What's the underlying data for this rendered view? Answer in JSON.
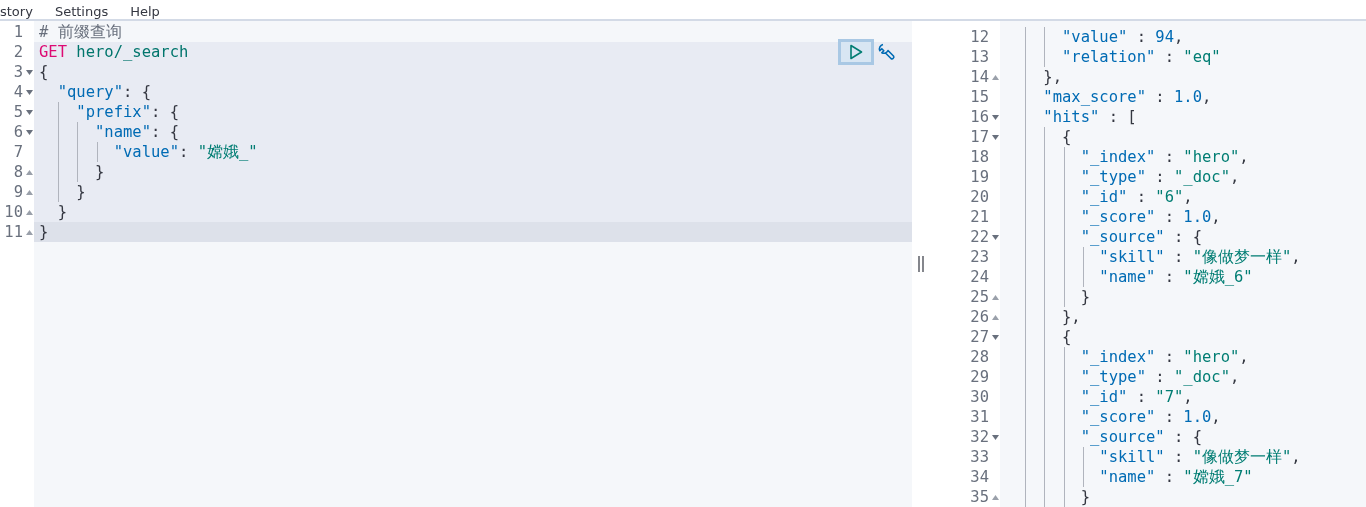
{
  "menu": [
    {
      "label": "story"
    },
    {
      "label": "Settings"
    },
    {
      "label": "Help"
    }
  ],
  "request_editor": {
    "lines": [
      {
        "number": "1",
        "fold_start": false,
        "fold_end": false,
        "in_request": false,
        "active": false,
        "tokens": [
          {
            "kind": "comment",
            "text": "# 前缀查询"
          }
        ]
      },
      {
        "number": "2",
        "fold_start": false,
        "fold_end": false,
        "in_request": true,
        "active": false,
        "tokens": [
          {
            "kind": "method",
            "text": "GET"
          },
          {
            "kind": "url",
            "text": " hero/_search"
          }
        ]
      },
      {
        "number": "3",
        "fold_start": true,
        "fold_end": false,
        "in_request": true,
        "active": false,
        "tokens": [
          {
            "kind": "punct",
            "text": "{"
          }
        ]
      },
      {
        "number": "4",
        "fold_start": true,
        "fold_end": false,
        "in_request": true,
        "active": false,
        "tokens": [
          {
            "kind": "key",
            "text": "  \"query\""
          },
          {
            "kind": "punct",
            "text": ": {"
          }
        ]
      },
      {
        "number": "5",
        "fold_start": true,
        "fold_end": false,
        "in_request": true,
        "active": false,
        "tokens": [
          {
            "kind": "key",
            "text": "    \"prefix\""
          },
          {
            "kind": "punct",
            "text": ": {"
          }
        ]
      },
      {
        "number": "6",
        "fold_start": true,
        "fold_end": false,
        "in_request": true,
        "active": false,
        "tokens": [
          {
            "kind": "key",
            "text": "      \"name\""
          },
          {
            "kind": "punct",
            "text": ": {"
          }
        ]
      },
      {
        "number": "7",
        "fold_start": false,
        "fold_end": false,
        "in_request": true,
        "active": false,
        "tokens": [
          {
            "kind": "key",
            "text": "        \"value\""
          },
          {
            "kind": "punct",
            "text": ": "
          },
          {
            "kind": "string",
            "text": "\"嫦娥_\""
          }
        ]
      },
      {
        "number": "8",
        "fold_start": false,
        "fold_end": true,
        "in_request": true,
        "active": false,
        "tokens": [
          {
            "kind": "punct",
            "text": "      }"
          }
        ]
      },
      {
        "number": "9",
        "fold_start": false,
        "fold_end": true,
        "in_request": true,
        "active": false,
        "tokens": [
          {
            "kind": "punct",
            "text": "    }"
          }
        ]
      },
      {
        "number": "10",
        "fold_start": false,
        "fold_end": true,
        "in_request": true,
        "active": false,
        "tokens": [
          {
            "kind": "punct",
            "text": "  }"
          }
        ]
      },
      {
        "number": "11",
        "fold_start": false,
        "fold_end": true,
        "in_request": true,
        "active": true,
        "tokens": [
          {
            "kind": "punct",
            "text": "}"
          }
        ]
      }
    ]
  },
  "response_viewer": {
    "lines": [
      {
        "number": "12",
        "fold_start": false,
        "fold_end": false,
        "tokens": [
          {
            "kind": "key",
            "text": "      \"value\""
          },
          {
            "kind": "punct",
            "text": " : "
          },
          {
            "kind": "number",
            "text": "94"
          },
          {
            "kind": "punct",
            "text": ","
          }
        ]
      },
      {
        "number": "13",
        "fold_start": false,
        "fold_end": false,
        "tokens": [
          {
            "kind": "key",
            "text": "      \"relation\""
          },
          {
            "kind": "punct",
            "text": " : "
          },
          {
            "kind": "string",
            "text": "\"eq\""
          }
        ]
      },
      {
        "number": "14",
        "fold_start": false,
        "fold_end": true,
        "tokens": [
          {
            "kind": "punct",
            "text": "    },"
          }
        ]
      },
      {
        "number": "15",
        "fold_start": false,
        "fold_end": false,
        "tokens": [
          {
            "kind": "key",
            "text": "    \"max_score\""
          },
          {
            "kind": "punct",
            "text": " : "
          },
          {
            "kind": "number",
            "text": "1.0"
          },
          {
            "kind": "punct",
            "text": ","
          }
        ]
      },
      {
        "number": "16",
        "fold_start": true,
        "fold_end": false,
        "tokens": [
          {
            "kind": "key",
            "text": "    \"hits\""
          },
          {
            "kind": "punct",
            "text": " : ["
          }
        ]
      },
      {
        "number": "17",
        "fold_start": true,
        "fold_end": false,
        "tokens": [
          {
            "kind": "punct",
            "text": "      {"
          }
        ]
      },
      {
        "number": "18",
        "fold_start": false,
        "fold_end": false,
        "tokens": [
          {
            "kind": "key",
            "text": "        \"_index\""
          },
          {
            "kind": "punct",
            "text": " : "
          },
          {
            "kind": "string",
            "text": "\"hero\""
          },
          {
            "kind": "punct",
            "text": ","
          }
        ]
      },
      {
        "number": "19",
        "fold_start": false,
        "fold_end": false,
        "tokens": [
          {
            "kind": "key",
            "text": "        \"_type\""
          },
          {
            "kind": "punct",
            "text": " : "
          },
          {
            "kind": "string",
            "text": "\"_doc\""
          },
          {
            "kind": "punct",
            "text": ","
          }
        ]
      },
      {
        "number": "20",
        "fold_start": false,
        "fold_end": false,
        "tokens": [
          {
            "kind": "key",
            "text": "        \"_id\""
          },
          {
            "kind": "punct",
            "text": " : "
          },
          {
            "kind": "string",
            "text": "\"6\""
          },
          {
            "kind": "punct",
            "text": ","
          }
        ]
      },
      {
        "number": "21",
        "fold_start": false,
        "fold_end": false,
        "tokens": [
          {
            "kind": "key",
            "text": "        \"_score\""
          },
          {
            "kind": "punct",
            "text": " : "
          },
          {
            "kind": "number",
            "text": "1.0"
          },
          {
            "kind": "punct",
            "text": ","
          }
        ]
      },
      {
        "number": "22",
        "fold_start": true,
        "fold_end": false,
        "tokens": [
          {
            "kind": "key",
            "text": "        \"_source\""
          },
          {
            "kind": "punct",
            "text": " : {"
          }
        ]
      },
      {
        "number": "23",
        "fold_start": false,
        "fold_end": false,
        "tokens": [
          {
            "kind": "key",
            "text": "          \"skill\""
          },
          {
            "kind": "punct",
            "text": " : "
          },
          {
            "kind": "string",
            "text": "\"像做梦一样\""
          },
          {
            "kind": "punct",
            "text": ","
          }
        ]
      },
      {
        "number": "24",
        "fold_start": false,
        "fold_end": false,
        "tokens": [
          {
            "kind": "key",
            "text": "          \"name\""
          },
          {
            "kind": "punct",
            "text": " : "
          },
          {
            "kind": "string",
            "text": "\"嫦娥_6\""
          }
        ]
      },
      {
        "number": "25",
        "fold_start": false,
        "fold_end": true,
        "tokens": [
          {
            "kind": "punct",
            "text": "        }"
          }
        ]
      },
      {
        "number": "26",
        "fold_start": false,
        "fold_end": true,
        "tokens": [
          {
            "kind": "punct",
            "text": "      },"
          }
        ]
      },
      {
        "number": "27",
        "fold_start": true,
        "fold_end": false,
        "tokens": [
          {
            "kind": "punct",
            "text": "      {"
          }
        ]
      },
      {
        "number": "28",
        "fold_start": false,
        "fold_end": false,
        "tokens": [
          {
            "kind": "key",
            "text": "        \"_index\""
          },
          {
            "kind": "punct",
            "text": " : "
          },
          {
            "kind": "string",
            "text": "\"hero\""
          },
          {
            "kind": "punct",
            "text": ","
          }
        ]
      },
      {
        "number": "29",
        "fold_start": false,
        "fold_end": false,
        "tokens": [
          {
            "kind": "key",
            "text": "        \"_type\""
          },
          {
            "kind": "punct",
            "text": " : "
          },
          {
            "kind": "string",
            "text": "\"_doc\""
          },
          {
            "kind": "punct",
            "text": ","
          }
        ]
      },
      {
        "number": "30",
        "fold_start": false,
        "fold_end": false,
        "tokens": [
          {
            "kind": "key",
            "text": "        \"_id\""
          },
          {
            "kind": "punct",
            "text": " : "
          },
          {
            "kind": "string",
            "text": "\"7\""
          },
          {
            "kind": "punct",
            "text": ","
          }
        ]
      },
      {
        "number": "31",
        "fold_start": false,
        "fold_end": false,
        "tokens": [
          {
            "kind": "key",
            "text": "        \"_score\""
          },
          {
            "kind": "punct",
            "text": " : "
          },
          {
            "kind": "number",
            "text": "1.0"
          },
          {
            "kind": "punct",
            "text": ","
          }
        ]
      },
      {
        "number": "32",
        "fold_start": true,
        "fold_end": false,
        "tokens": [
          {
            "kind": "key",
            "text": "        \"_source\""
          },
          {
            "kind": "punct",
            "text": " : {"
          }
        ]
      },
      {
        "number": "33",
        "fold_start": false,
        "fold_end": false,
        "tokens": [
          {
            "kind": "key",
            "text": "          \"skill\""
          },
          {
            "kind": "punct",
            "text": " : "
          },
          {
            "kind": "string",
            "text": "\"像做梦一样\""
          },
          {
            "kind": "punct",
            "text": ","
          }
        ]
      },
      {
        "number": "34",
        "fold_start": false,
        "fold_end": false,
        "tokens": [
          {
            "kind": "key",
            "text": "          \"name\""
          },
          {
            "kind": "punct",
            "text": " : "
          },
          {
            "kind": "string",
            "text": "\"嫦娥_7\""
          }
        ]
      },
      {
        "number": "35",
        "fold_start": false,
        "fold_end": true,
        "tokens": [
          {
            "kind": "punct",
            "text": "        }"
          }
        ]
      }
    ]
  }
}
